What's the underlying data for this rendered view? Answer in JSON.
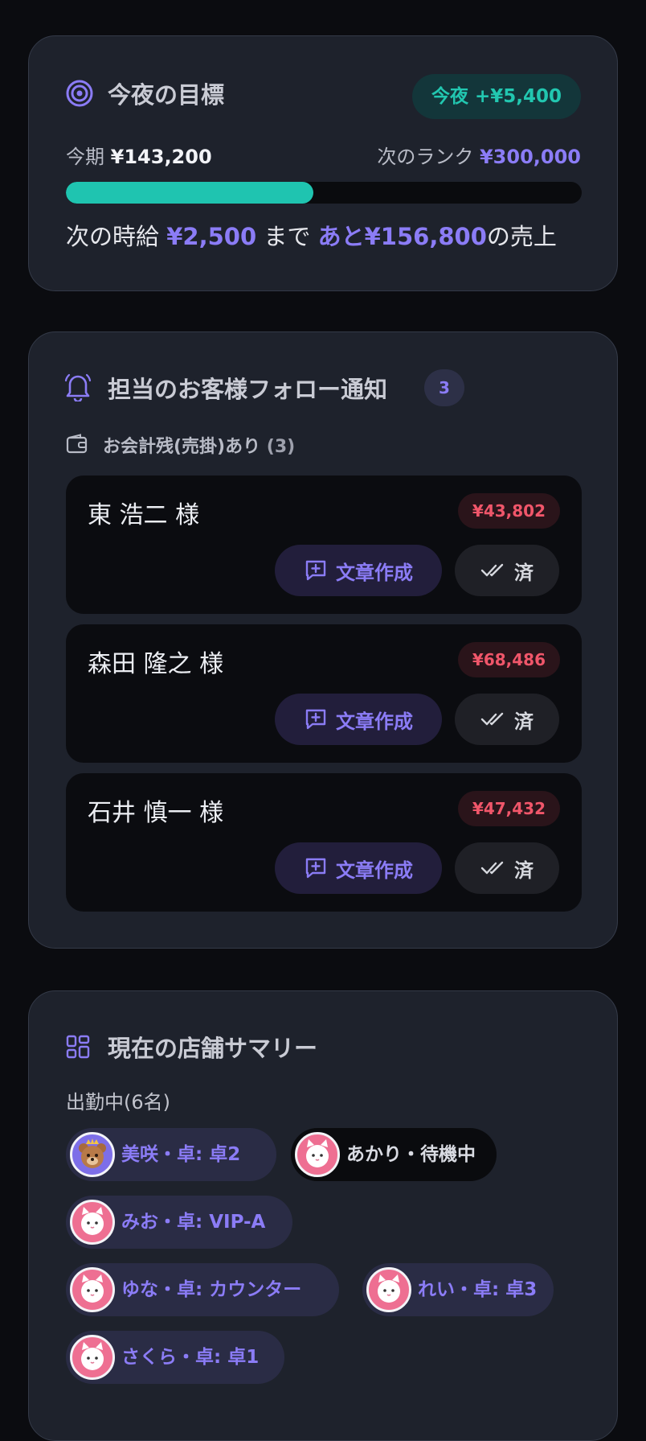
{
  "goal": {
    "title": "今夜の目標",
    "tonight_label": "今夜",
    "tonight_value": "+¥5,400",
    "period_label": "今期",
    "period_value": "¥143,200",
    "next_rank_label": "次のランク",
    "next_rank_value": "¥300,000",
    "progress": 0.48,
    "hint_prefix": "次の時給",
    "hint_wage": "¥2,500",
    "hint_mid": "まで",
    "hint_remaining": "あと¥156,800",
    "hint_suffix": "の売上",
    "accent": "#1fc4b0",
    "primary": "#8b7cf6"
  },
  "follow": {
    "title": "担当のお客様フォロー通知",
    "count": "3",
    "subheading": "お会計残(売掛)あり",
    "sub_count": "(3)",
    "compose_label": "文章作成",
    "done_label": "済",
    "customers": [
      {
        "name": "東 浩二 様",
        "amount": "¥43,802"
      },
      {
        "name": "森田 隆之 様",
        "amount": "¥68,486"
      },
      {
        "name": "石井 慎一 様",
        "amount": "¥47,432"
      }
    ],
    "amount_color": "#f0566a"
  },
  "store": {
    "title": "現在の店舗サマリー",
    "working_label": "出勤中(6名)",
    "staff": [
      {
        "label": "美咲・卓: 卓2",
        "avatar": "bear-avatar",
        "status": "table"
      },
      {
        "label": "あかり・待機中",
        "avatar": "cat-avatar",
        "status": "waiting"
      },
      {
        "label": "みお・卓: VIP-A",
        "avatar": "cat-avatar",
        "status": "table"
      },
      {
        "label": "ゆな・卓: カウンター",
        "avatar": "cat-avatar",
        "status": "table"
      },
      {
        "label": "れい・卓: 卓3",
        "avatar": "cat-avatar",
        "status": "table"
      },
      {
        "label": "さくら・卓: 卓1",
        "avatar": "cat-avatar",
        "status": "table"
      }
    ]
  }
}
